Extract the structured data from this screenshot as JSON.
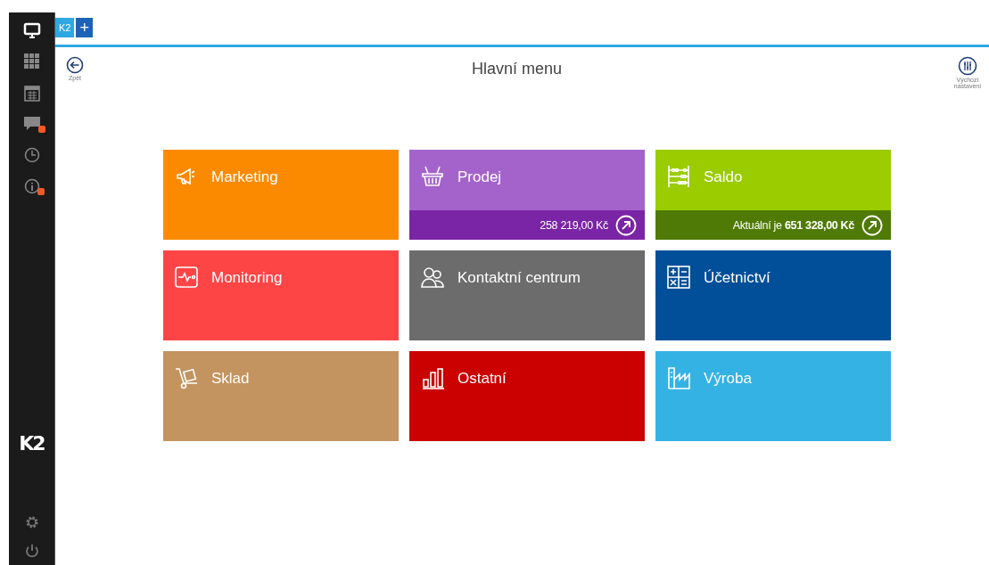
{
  "sidebar": {
    "items": [
      {
        "kind": "monitor",
        "selected": true,
        "badge": false
      },
      {
        "kind": "apps",
        "selected": false,
        "badge": false
      },
      {
        "kind": "calendar",
        "selected": false,
        "badge": false
      },
      {
        "kind": "chat",
        "selected": false,
        "badge": true
      },
      {
        "kind": "clock",
        "selected": false,
        "badge": false
      },
      {
        "kind": "info",
        "selected": false,
        "badge": true
      }
    ],
    "logo": "K2",
    "bottom_items": [
      {
        "kind": "settings"
      },
      {
        "kind": "power"
      }
    ]
  },
  "tabs": [
    {
      "label": "K2",
      "selected": false
    },
    {
      "label": "+",
      "selected": true
    }
  ],
  "header": {
    "back_label": "Zpět",
    "title": "Hlavní menu",
    "defaults_label": "Výchozí nastavení"
  },
  "tiles": [
    {
      "label": "Marketing",
      "color": "#fb8a00"
    },
    {
      "label": "Prodej",
      "color": "#a463cb",
      "footer": {
        "text": "258 219,00 Kč",
        "color": "#7a24a6"
      }
    },
    {
      "label": "Saldo",
      "color": "#9acc00",
      "footer": {
        "text": "Aktuální je **651 328,00 Kč**",
        "color": "#4f7a05"
      }
    },
    {
      "label": "Monitoring",
      "color": "#fd4546"
    },
    {
      "label": "Kontaktní centrum",
      "color": "#6c6c6c"
    },
    {
      "label": "Účetnictví",
      "color": "#024f99"
    },
    {
      "label": "Sklad",
      "color": "#c39360"
    },
    {
      "label": "Ostatní",
      "color": "#cb0000"
    },
    {
      "label": "Výroba",
      "color": "#34b2e4"
    }
  ]
}
